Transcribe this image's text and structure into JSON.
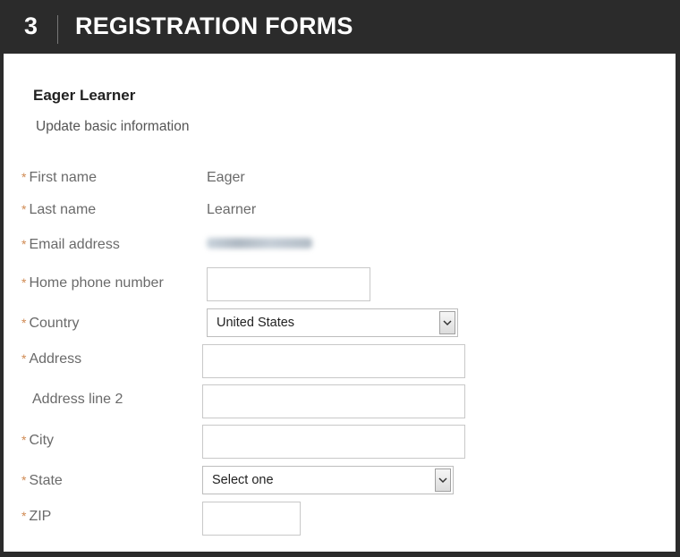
{
  "header": {
    "step_number": "3",
    "title": "REGISTRATION FORMS"
  },
  "learner": {
    "name": "Eager Learner",
    "update_link": "Update basic information"
  },
  "fields": {
    "first_name": {
      "label": "First name",
      "value": "Eager"
    },
    "last_name": {
      "label": "Last name",
      "value": "Learner"
    },
    "email": {
      "label": "Email address"
    },
    "home_phone": {
      "label": "Home phone number",
      "value": ""
    },
    "country": {
      "label": "Country",
      "selected": "United States"
    },
    "address": {
      "label": "Address",
      "value": ""
    },
    "address2": {
      "label": "Address line 2",
      "value": ""
    },
    "city": {
      "label": "City",
      "value": ""
    },
    "state": {
      "label": "State",
      "selected": "Select one"
    },
    "zip": {
      "label": "ZIP",
      "value": ""
    }
  },
  "required_marker": "*",
  "colors": {
    "header_bg": "#2b2b2b",
    "required_marker": "#d08a52",
    "label_text": "#6a6a6a"
  }
}
